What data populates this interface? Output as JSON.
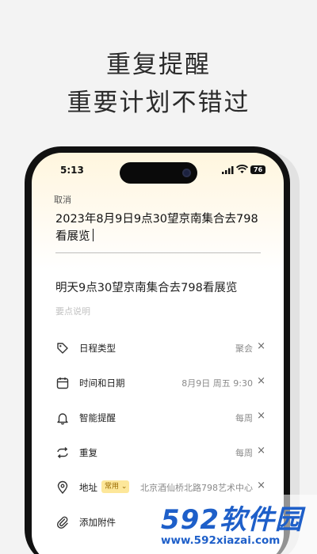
{
  "marketing": {
    "line1": "重复提醒",
    "line2": "重要计划不错过"
  },
  "status_bar": {
    "time": "5:13",
    "battery": "76"
  },
  "editor": {
    "cancel_label": "取消",
    "input_line1": "2023年8月9日9点30望京南集合去798",
    "input_line2": "看展览",
    "parsed_title": "明天9点30望京南集合去798看展览",
    "notes_placeholder": "要点说明"
  },
  "fields": [
    {
      "label": "日程类型",
      "value": "聚会",
      "icon": "tag-icon"
    },
    {
      "label": "时间和日期",
      "value": "8月9日  周五  9:30",
      "icon": "calendar-icon"
    },
    {
      "label": "智能提醒",
      "value": "每周",
      "icon": "bell-icon"
    },
    {
      "label": "重复",
      "value": "每周",
      "icon": "repeat-icon"
    },
    {
      "label": "地址",
      "badge": "常用",
      "value": "北京酒仙桥北路798艺术中心",
      "icon": "location-pin-icon"
    },
    {
      "label": "添加附件",
      "icon": "paperclip-icon"
    }
  ],
  "watermark": {
    "brand": "592软件园",
    "url": "www.592xiazai.com"
  },
  "colors": {
    "accent_badge": "#fde79a",
    "header_gradient": "#fff6de",
    "watermark": "#1e5fc9"
  }
}
